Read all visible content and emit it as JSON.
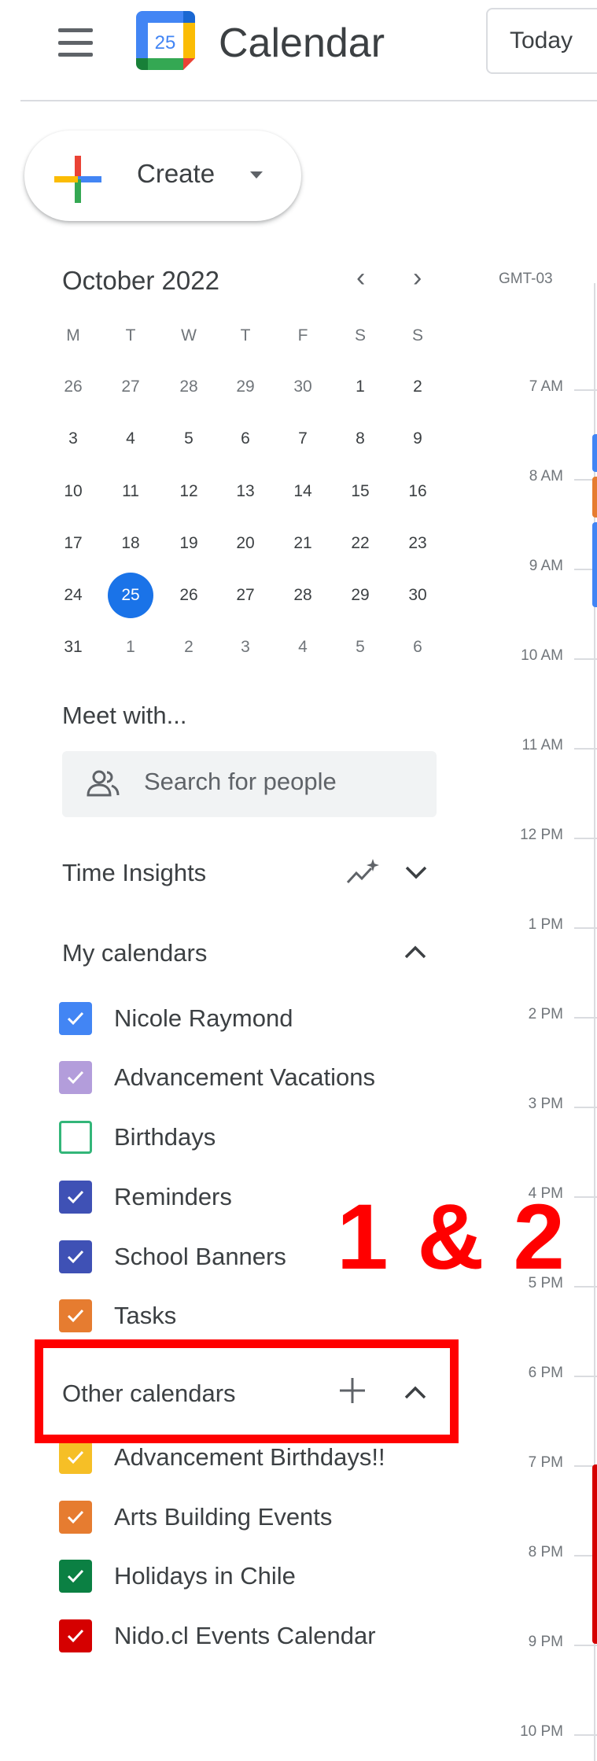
{
  "header": {
    "app_title": "Calendar",
    "logo_day": "25",
    "today_label": "Today"
  },
  "create": {
    "label": "Create"
  },
  "mini_calendar": {
    "month_title": "October 2022",
    "weekdays": [
      "M",
      "T",
      "W",
      "T",
      "F",
      "S",
      "S"
    ],
    "weeks": [
      [
        "26",
        "27",
        "28",
        "29",
        "30",
        "1",
        "2"
      ],
      [
        "3",
        "4",
        "5",
        "6",
        "7",
        "8",
        "9"
      ],
      [
        "10",
        "11",
        "12",
        "13",
        "14",
        "15",
        "16"
      ],
      [
        "17",
        "18",
        "19",
        "20",
        "21",
        "22",
        "23"
      ],
      [
        "24",
        "25",
        "26",
        "27",
        "28",
        "29",
        "30"
      ],
      [
        "31",
        "1",
        "2",
        "3",
        "4",
        "5",
        "6"
      ]
    ],
    "selected_day": "25"
  },
  "meet_with": {
    "title": "Meet with...",
    "search_placeholder": "Search for people"
  },
  "time_insights": {
    "title": "Time Insights"
  },
  "my_calendars": {
    "title": "My calendars",
    "items": [
      {
        "label": "Nicole Raymond",
        "color": "#4285f4",
        "checked": true
      },
      {
        "label": "Advancement Vacations",
        "color": "#b39ddb",
        "checked": true
      },
      {
        "label": "Birthdays",
        "color": "#33b679",
        "checked": false
      },
      {
        "label": "Reminders",
        "color": "#3f51b5",
        "checked": true
      },
      {
        "label": "School Banners",
        "color": "#3f51b5",
        "checked": true
      },
      {
        "label": "Tasks",
        "color": "#e67c30",
        "checked": true
      }
    ]
  },
  "other_calendars": {
    "title": "Other calendars",
    "items": [
      {
        "label": "Advancement Birthdays!!",
        "color": "#f6bf26",
        "checked": true
      },
      {
        "label": "Arts Building Events",
        "color": "#e67c30",
        "checked": true
      },
      {
        "label": "Holidays in Chile",
        "color": "#0b8043",
        "checked": true
      },
      {
        "label": "Nido.cl Events Calendar",
        "color": "#d50000",
        "checked": true
      }
    ]
  },
  "annotation": {
    "text": "1 & 2",
    "color": "#ff0000"
  },
  "timezone": "GMT-03",
  "time_labels": [
    "7 AM",
    "8 AM",
    "9 AM",
    "10 AM",
    "11 AM",
    "12 PM",
    "1 PM",
    "2 PM",
    "3 PM",
    "4 PM",
    "5 PM",
    "6 PM",
    "7 PM",
    "8 PM",
    "9 PM",
    "10 PM"
  ],
  "colors": {
    "accent": "#1a73e8",
    "highlight": "#ff0000"
  }
}
